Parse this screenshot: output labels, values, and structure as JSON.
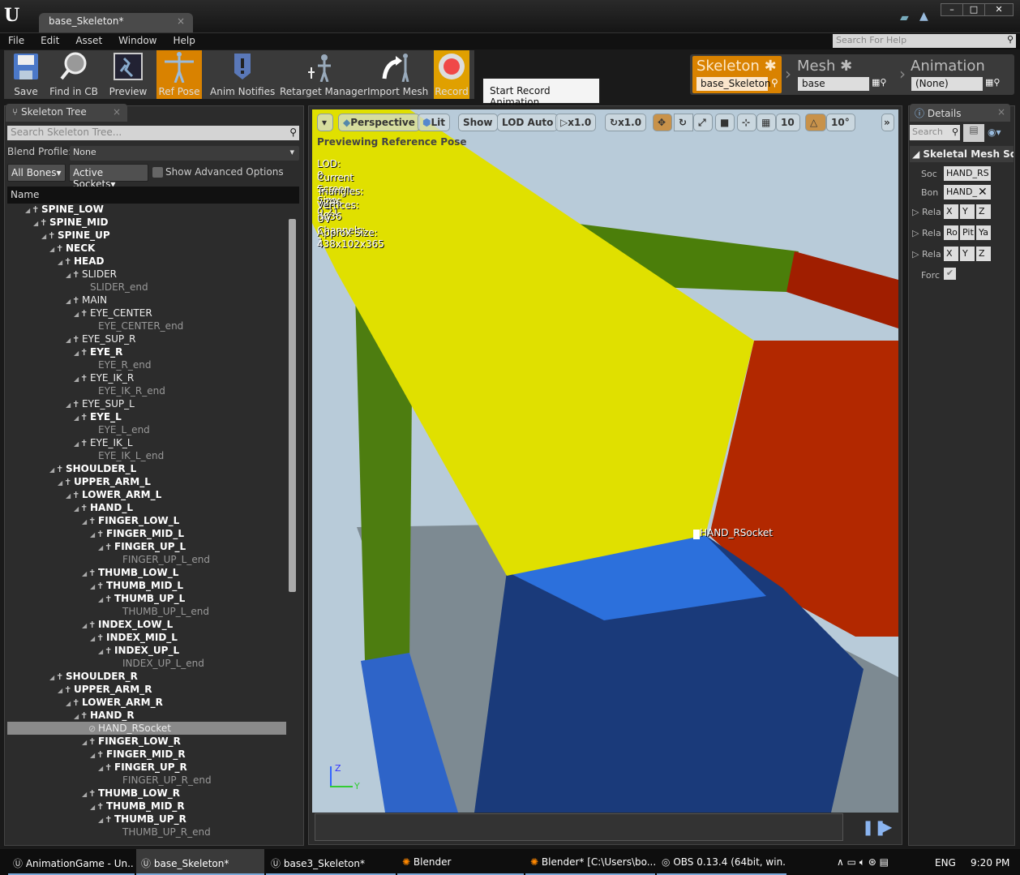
{
  "window": {
    "doc_tab": "base_Skeleton*",
    "logo": "U"
  },
  "menu": [
    "File",
    "Edit",
    "Asset",
    "Window",
    "Help"
  ],
  "help_search_placeholder": "Search For Help",
  "toolbar": [
    {
      "label": "Save",
      "icon": "save-icon"
    },
    {
      "label": "Find in CB",
      "icon": "magnifier-icon"
    },
    {
      "label": "Preview",
      "icon": "preview-icon"
    },
    {
      "label": "Ref Pose",
      "icon": "ref-pose-icon",
      "active": true
    },
    {
      "label": "Anim Notifies",
      "icon": "anim-notify-icon"
    },
    {
      "label": "Retarget Manager",
      "icon": "retarget-icon"
    },
    {
      "label": "Import Mesh",
      "icon": "import-mesh-icon"
    },
    {
      "label": "Record",
      "icon": "record-icon",
      "active": true
    }
  ],
  "tooltip": "Start Record Animation",
  "asset_bar": {
    "skeleton": {
      "title": "Skeleton",
      "value": "base_Skeleton"
    },
    "mesh": {
      "title": "Mesh",
      "value": "base"
    },
    "animation": {
      "title": "Animation",
      "value": "(None)"
    }
  },
  "skeleton_tree": {
    "tab": "Skeleton Tree",
    "search_placeholder": "Search Skeleton Tree...",
    "blend_profile_label": "Blend Profile:",
    "blend_profile_value": "None",
    "all_bones": "All Bones",
    "active_sockets": "Active Sockets",
    "show_advanced": "Show Advanced Options",
    "column": "Name",
    "rows": [
      {
        "name": "SPINE_LOW",
        "level": 0,
        "kind": "bold"
      },
      {
        "name": "SPINE_MID",
        "level": 1,
        "kind": "bold"
      },
      {
        "name": "SPINE_UP",
        "level": 2,
        "kind": "bold"
      },
      {
        "name": "NECK",
        "level": 3,
        "kind": "bold"
      },
      {
        "name": "HEAD",
        "level": 4,
        "kind": "bold"
      },
      {
        "name": "SLIDER",
        "level": 5,
        "kind": "normal"
      },
      {
        "name": "SLIDER_end",
        "level": 6,
        "kind": "end"
      },
      {
        "name": "MAIN",
        "level": 5,
        "kind": "normal"
      },
      {
        "name": "EYE_CENTER",
        "level": 6,
        "kind": "normal"
      },
      {
        "name": "EYE_CENTER_end",
        "level": 7,
        "kind": "end"
      },
      {
        "name": "EYE_SUP_R",
        "level": 5,
        "kind": "normal"
      },
      {
        "name": "EYE_R",
        "level": 6,
        "kind": "bold"
      },
      {
        "name": "EYE_R_end",
        "level": 7,
        "kind": "end"
      },
      {
        "name": "EYE_IK_R",
        "level": 6,
        "kind": "normal"
      },
      {
        "name": "EYE_IK_R_end",
        "level": 7,
        "kind": "end"
      },
      {
        "name": "EYE_SUP_L",
        "level": 5,
        "kind": "normal"
      },
      {
        "name": "EYE_L",
        "level": 6,
        "kind": "bold"
      },
      {
        "name": "EYE_L_end",
        "level": 7,
        "kind": "end"
      },
      {
        "name": "EYE_IK_L",
        "level": 6,
        "kind": "normal"
      },
      {
        "name": "EYE_IK_L_end",
        "level": 7,
        "kind": "end"
      },
      {
        "name": "SHOULDER_L",
        "level": 3,
        "kind": "bold"
      },
      {
        "name": "UPPER_ARM_L",
        "level": 4,
        "kind": "bold"
      },
      {
        "name": "LOWER_ARM_L",
        "level": 5,
        "kind": "bold"
      },
      {
        "name": "HAND_L",
        "level": 6,
        "kind": "bold"
      },
      {
        "name": "FINGER_LOW_L",
        "level": 7,
        "kind": "bold"
      },
      {
        "name": "FINGER_MID_L",
        "level": 8,
        "kind": "bold"
      },
      {
        "name": "FINGER_UP_L",
        "level": 9,
        "kind": "bold"
      },
      {
        "name": "FINGER_UP_L_end",
        "level": 10,
        "kind": "end"
      },
      {
        "name": "THUMB_LOW_L",
        "level": 7,
        "kind": "bold"
      },
      {
        "name": "THUMB_MID_L",
        "level": 8,
        "kind": "bold"
      },
      {
        "name": "THUMB_UP_L",
        "level": 9,
        "kind": "bold"
      },
      {
        "name": "THUMB_UP_L_end",
        "level": 10,
        "kind": "end"
      },
      {
        "name": "INDEX_LOW_L",
        "level": 7,
        "kind": "bold"
      },
      {
        "name": "INDEX_MID_L",
        "level": 8,
        "kind": "bold"
      },
      {
        "name": "INDEX_UP_L",
        "level": 9,
        "kind": "bold"
      },
      {
        "name": "INDEX_UP_L_end",
        "level": 10,
        "kind": "end"
      },
      {
        "name": "SHOULDER_R",
        "level": 3,
        "kind": "bold"
      },
      {
        "name": "UPPER_ARM_R",
        "level": 4,
        "kind": "bold"
      },
      {
        "name": "LOWER_ARM_R",
        "level": 5,
        "kind": "bold"
      },
      {
        "name": "HAND_R",
        "level": 6,
        "kind": "bold"
      },
      {
        "name": "HAND_RSocket",
        "level": 7,
        "kind": "socket",
        "selected": true
      },
      {
        "name": "FINGER_LOW_R",
        "level": 7,
        "kind": "bold"
      },
      {
        "name": "FINGER_MID_R",
        "level": 8,
        "kind": "bold"
      },
      {
        "name": "FINGER_UP_R",
        "level": 9,
        "kind": "bold"
      },
      {
        "name": "FINGER_UP_R_end",
        "level": 10,
        "kind": "end"
      },
      {
        "name": "THUMB_LOW_R",
        "level": 7,
        "kind": "bold"
      },
      {
        "name": "THUMB_MID_R",
        "level": 8,
        "kind": "bold"
      },
      {
        "name": "THUMB_UP_R",
        "level": 9,
        "kind": "bold"
      },
      {
        "name": "THUMB_UP_R_end",
        "level": 10,
        "kind": "end"
      }
    ]
  },
  "viewport": {
    "buttons": [
      "Perspective",
      "Lit",
      "Show",
      "LOD Auto",
      "x1.0",
      "x1.0",
      "10",
      "10°"
    ],
    "status": "Previewing Reference Pose",
    "stats": [
      "LOD: 0",
      "Current Screen Size: 0.21",
      "Triangles: 7296",
      "Vertices: 3836",
      "UV Channels: 1",
      "Approx Size: 438x102x365"
    ],
    "socket_label": "HAND_RSocket",
    "axis_z": "Z",
    "axis_y": "Y"
  },
  "details": {
    "tab": "Details",
    "search_placeholder": "Search",
    "section": "Skeletal Mesh So",
    "rows": [
      {
        "label": "Soc",
        "values": [
          "HAND_RS"
        ]
      },
      {
        "label": "Bon",
        "values": [
          "HAND_"
        ]
      },
      {
        "label": "Rela",
        "values": [
          "X",
          "Y",
          "Z"
        ]
      },
      {
        "label": "Rela",
        "values": [
          "Ro",
          "Pit",
          "Ya"
        ]
      },
      {
        "label": "Rela",
        "values": [
          "X",
          "Y",
          "Z"
        ]
      },
      {
        "label": "Forc",
        "checked": true
      }
    ]
  },
  "taskbar": {
    "items": [
      "AnimationGame - Un...",
      "base_Skeleton*",
      "base3_Skeleton*",
      "Blender",
      "Blender* [C:\\Users\\bo...",
      "OBS 0.13.4 (64bit, win..."
    ],
    "lang": "ENG",
    "time": "9:20 PM"
  },
  "colors": {
    "accent": "#d98200",
    "record": "#e0a000",
    "selected_row": "#8a8a8a"
  }
}
